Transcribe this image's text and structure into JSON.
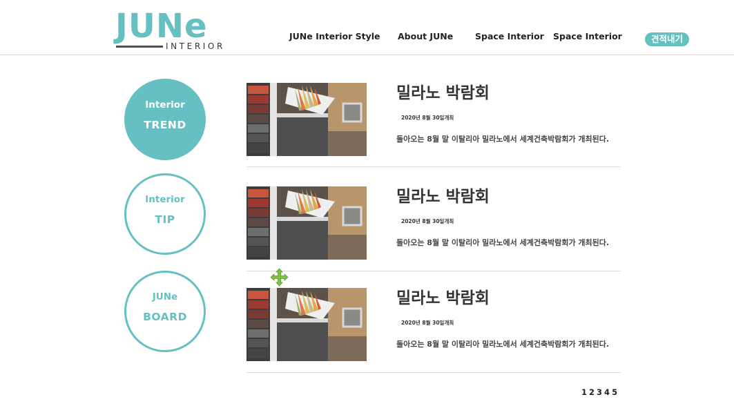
{
  "header": {
    "logo": {
      "main": "JUNe",
      "sub": "INTERIOR"
    },
    "nav": [
      {
        "label": "JUNe  Interior Style"
      },
      {
        "label": "About JUNe"
      },
      {
        "label": "Space Interior"
      },
      {
        "label": "Space Interior"
      }
    ],
    "quote_button": "견적내기"
  },
  "sidebar": {
    "items": [
      {
        "line1": "Interior",
        "line2": "TREND",
        "active": true
      },
      {
        "line1": "Interior",
        "line2": "TIP",
        "active": false
      },
      {
        "line1": "JUNe",
        "line2": "BOARD",
        "active": false
      }
    ]
  },
  "posts": [
    {
      "title": "밀라노 박람회",
      "date": "2020년 8월 30일개최",
      "description": "돌아오는 8월 말 이탈리아 밀라노에서 세계건축박람회가 개최된다."
    },
    {
      "title": "밀라노 박람회",
      "date": "2020년 8월 30일개최",
      "description": "돌아오는 8월 말 이탈리아 밀라노에서 세계건축박람회가 개최된다."
    },
    {
      "title": "밀라노 박람회",
      "date": "2020년 8월 30일개최",
      "description": "돌아오는 8월 말 이탈리아 밀라노에서 세계건축박람회가 개최된다."
    }
  ],
  "pagination": {
    "pages": [
      "1",
      "2",
      "3",
      "4",
      "5"
    ]
  },
  "colors": {
    "accent": "#66bfc1",
    "move_cursor": "#7dc242"
  },
  "icons": {
    "thumbnail": "color-swatch-image",
    "move": "move-arrows-icon"
  }
}
